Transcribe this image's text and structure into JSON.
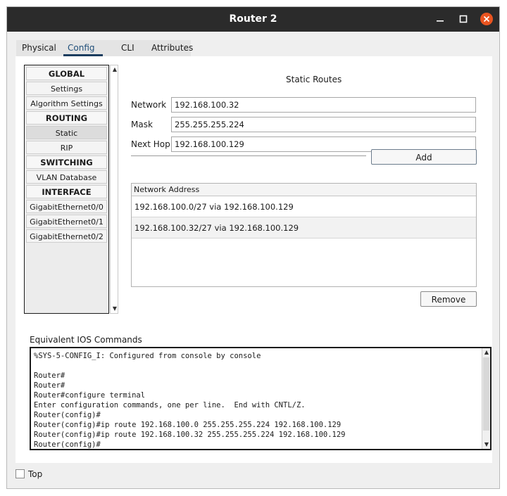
{
  "window": {
    "title": "Router 2",
    "colors": {
      "titlebar": "#2b2b2b",
      "close": "#e95420"
    }
  },
  "tabs": [
    {
      "label": "Physical"
    },
    {
      "label": "Config",
      "active": true
    },
    {
      "label": "CLI"
    },
    {
      "label": "Attributes"
    }
  ],
  "sidebar": {
    "items": [
      {
        "label": "GLOBAL",
        "kind": "header"
      },
      {
        "label": "Settings"
      },
      {
        "label": "Algorithm Settings"
      },
      {
        "label": "ROUTING",
        "kind": "header"
      },
      {
        "label": "Static",
        "selected": true
      },
      {
        "label": "RIP"
      },
      {
        "label": "SWITCHING",
        "kind": "header"
      },
      {
        "label": "VLAN Database"
      },
      {
        "label": "INTERFACE",
        "kind": "header"
      },
      {
        "label": "GigabitEthernet0/0"
      },
      {
        "label": "GigabitEthernet0/1"
      },
      {
        "label": "GigabitEthernet0/2"
      }
    ]
  },
  "static_routes": {
    "title": "Static Routes",
    "network_label": "Network",
    "network_value": "192.168.100.32",
    "mask_label": "Mask",
    "mask_value": "255.255.255.224",
    "nexthop_label": "Next Hop",
    "nexthop_value": "192.168.100.129",
    "add_label": "Add",
    "table_header": "Network Address",
    "routes": [
      "192.168.100.0/27 via 192.168.100.129",
      "192.168.100.32/27 via 192.168.100.129"
    ],
    "remove_label": "Remove"
  },
  "ios": {
    "label": "Equivalent IOS Commands",
    "lines": [
      "%SYS-5-CONFIG_I: Configured from console by console",
      "",
      "Router#",
      "Router#",
      "Router#configure terminal",
      "Enter configuration commands, one per line.  End with CNTL/Z.",
      "Router(config)#",
      "Router(config)#ip route 192.168.100.0 255.255.255.224 192.168.100.129",
      "Router(config)#ip route 192.168.100.32 255.255.255.224 192.168.100.129",
      "Router(config)#"
    ]
  },
  "footer": {
    "top_label": "Top",
    "top_checked": false
  }
}
